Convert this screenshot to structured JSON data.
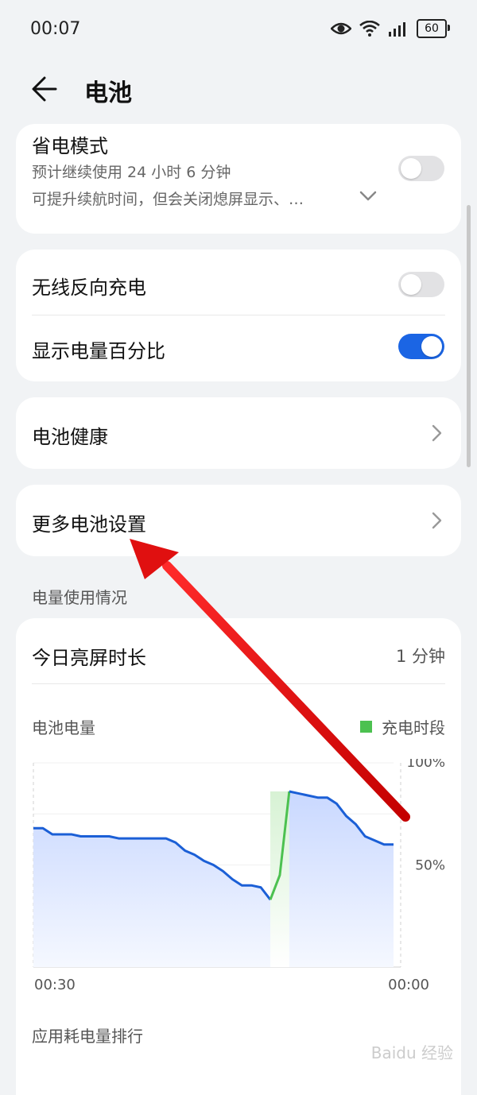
{
  "status": {
    "time": "00:07",
    "battery": "60"
  },
  "header": {
    "title": "电池"
  },
  "power_saving": {
    "title": "省电模式",
    "line1": "预计继续使用 24 小时 6 分钟",
    "line2": "可提升续航时间，但会关闭熄屏显示、…"
  },
  "settings": {
    "wireless_reverse": "无线反向充电",
    "show_percentage": "显示电量百分比",
    "battery_health": "电池健康",
    "more_settings": "更多电池设置"
  },
  "toggles": {
    "power_saving_on": false,
    "wireless_reverse_on": false,
    "show_percentage_on": true
  },
  "usage": {
    "section_label": "电量使用情况",
    "screen_time_label": "今日亮屏时长",
    "screen_time_value": "1 分钟",
    "battery_level_label": "电池电量",
    "legend_charging": "充电时段",
    "next_section": "应用耗电量排行"
  },
  "chart_data": {
    "type": "area",
    "x_range_labels": [
      "00:30",
      "00:00"
    ],
    "y_tick_labels": [
      "100%",
      "50%"
    ],
    "ylim": [
      0,
      100
    ],
    "values": [
      68,
      68,
      65,
      65,
      65,
      64,
      64,
      64,
      64,
      63,
      63,
      63,
      63,
      63,
      63,
      61,
      57,
      55,
      52,
      50,
      47,
      43,
      40,
      40,
      39,
      33,
      45,
      86,
      85,
      84,
      83,
      83,
      80,
      74,
      70,
      64,
      62,
      60,
      60
    ],
    "charging_segment_index": [
      25,
      27
    ],
    "legend": [
      {
        "name": "充电时段",
        "color": "#4cc150"
      }
    ],
    "colors": {
      "line": "#1b5fd6",
      "charging": "#4cc150",
      "fill_top": "#c9d8ff",
      "fill_bottom": "#f5f8ff"
    }
  },
  "watermark": "Baidu 经验"
}
